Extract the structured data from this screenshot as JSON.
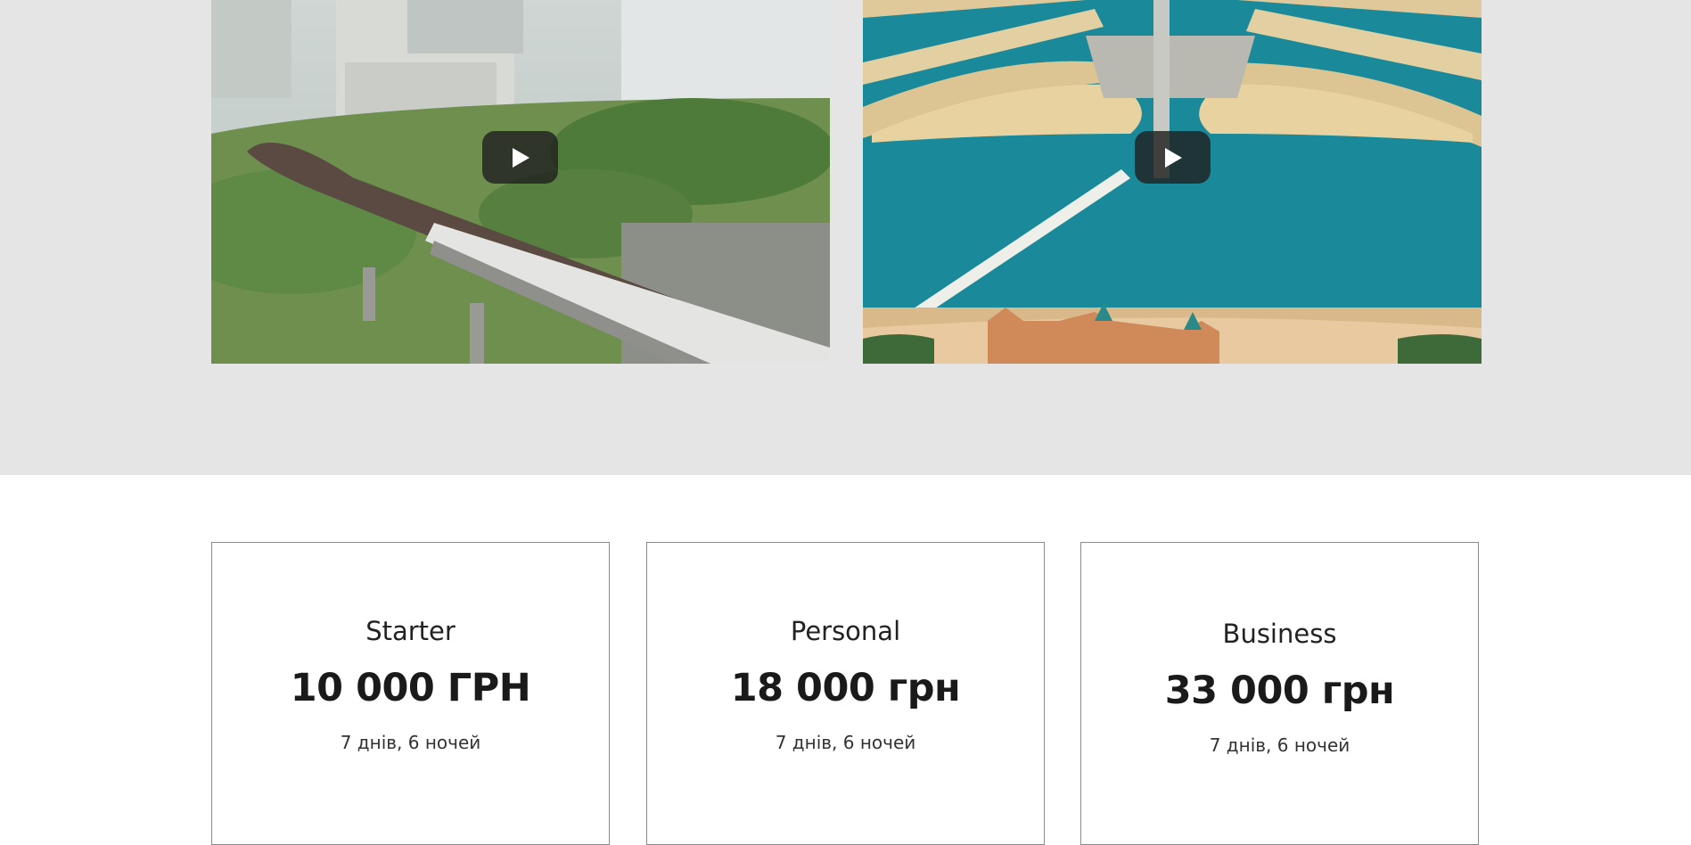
{
  "videos": [
    {
      "thumbnail": "metro-train-on-viaduct-thumbnail",
      "play_icon": "play-icon"
    },
    {
      "thumbnail": "palm-island-aerial-thumbnail",
      "play_icon": "play-icon"
    }
  ],
  "pricing": {
    "plans": [
      {
        "name": "Starter",
        "price": "10 000 ГРН",
        "duration": "7 днів, 6 ночей"
      },
      {
        "name": "Personal",
        "price": "18 000 грн",
        "duration": "7 днів, 6 ночей"
      },
      {
        "name": "Business",
        "price": "33 000 грн",
        "duration": "7 днів, 6 ночей"
      }
    ]
  },
  "colors": {
    "section_bg": "#e5e5e5",
    "card_border": "#8a8a8a",
    "text_dark": "#1a1a1a"
  }
}
